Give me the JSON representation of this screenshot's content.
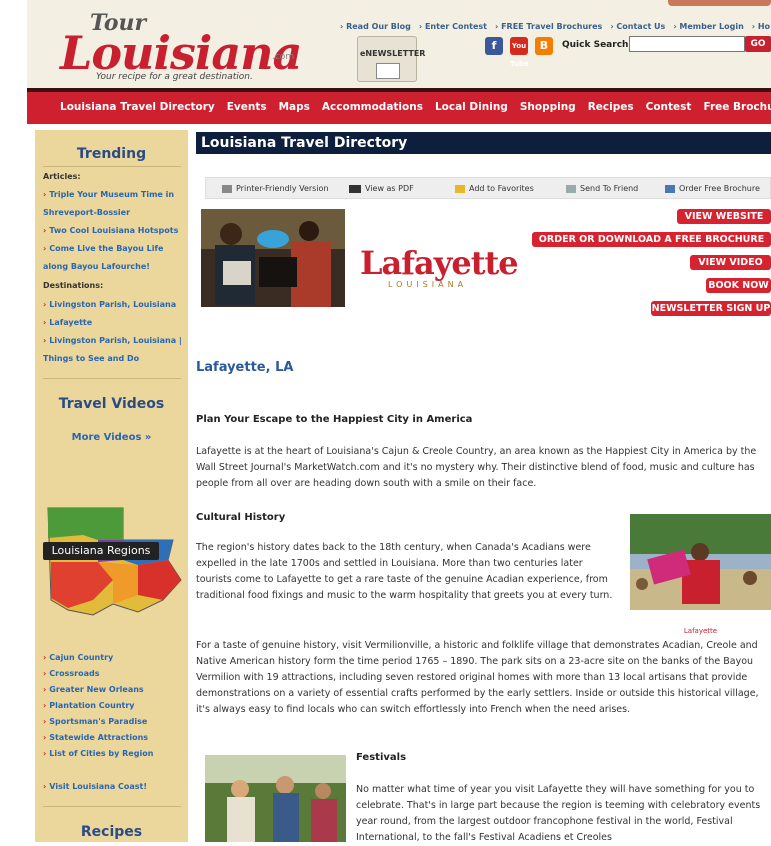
{
  "header": {
    "logo_tour": "Tour",
    "logo_main": "Louisiana",
    "logo_com": ".com",
    "tagline": "Your recipe for a great destination.",
    "newsletter": "eNEWSLETTER",
    "top_links": [
      "› Read Our Blog",
      "› Enter Contest",
      "› FREE Travel Brochures",
      "› Contact Us",
      "› Member Login",
      "› Ho"
    ],
    "search_label": "Quick Search:",
    "search_value": "",
    "search_button": "GO",
    "social": [
      "f",
      "You Tube",
      "B"
    ]
  },
  "nav": [
    "Louisiana Travel Directory",
    "Events",
    "Maps",
    "Accommodations",
    "Local Dining",
    "Shopping",
    "Recipes",
    "Contest",
    "Free Brochures"
  ],
  "sidebar": {
    "trending": "Trending",
    "articles_label": "Articles:",
    "articles": [
      "Triple Your Museum Time in Shreveport-Bossier",
      "Two Cool Louisiana Hotspots",
      "Come Live the Bayou Life along Bayou Lafourche!"
    ],
    "destinations_label": "Destinations:",
    "destinations": [
      "Livingston Parish, Louisiana",
      "Lafayette",
      "Livingston Parish, Louisiana | Things to See and Do"
    ],
    "travel_videos": "Travel Videos",
    "more_videos": "More Videos »",
    "regions_label": "Louisiana Regions",
    "regions": [
      "Cajun Country",
      "Crossroads",
      "Greater New Orleans",
      "Plantation Country",
      "Sportsman's Paradise",
      "Statewide Attractions",
      "List of Cities by Region"
    ],
    "coast": "Visit Louisiana Coast!",
    "recipes": "Recipes"
  },
  "content": {
    "title": "Louisiana Travel Directory",
    "tools": [
      "Printer-Friendly Version",
      "View as PDF",
      "Add to Favorites",
      "Send To Friend",
      "Order Free Brochure"
    ],
    "logo_text": "Lafayette",
    "logo_sub": "LOUISIANA",
    "buttons": [
      "VIEW WEBSITE",
      "ORDER OR DOWNLOAD A FREE BROCHURE",
      "VIEW VIDEO",
      "BOOK NOW",
      "NEWSLETTER SIGN UP"
    ],
    "heading": "Lafayette, LA",
    "escape_heading": "Plan Your Escape to the Happiest City in America",
    "escape_text": "Lafayette is at the heart of Louisiana's Cajun & Creole Country, an area known as the Happiest City in America by the Wall Street Journal's MarketWatch.com and it's no mystery why. Their distinctive blend of food, music and culture has people from all over are heading down south with a smile on their face.",
    "culture_heading": "Cultural History",
    "culture_text": "The region's history dates back to the 18th century, when Canada's Acadians were expelled in the late 1700s and settled in Louisiana. More than two centuries later tourists come to Lafayette to get a rare taste of the genuine Acadian experience, from traditional food fixings and music to the warm hospitality that greets you at every turn.",
    "photo_caption": "Lafayette",
    "vermilion_text": "For a taste of genuine history, visit Vermilionville, a historic and folklife village that demonstrates Acadian, Creole and Native American history form the time period 1765 – 1890. The park sits on a 23-acre site on the banks of the Bayou Vermilion with 19 attractions, including seven restored original homes with more than 13 local artisans that provide demonstrations on a variety of essential crafts performed by the early settlers. Inside or outside this historical village, it's always easy to find locals who can switch effortlessly into French when the need arises.",
    "festivals_heading": "Festivals",
    "festivals_text": "No matter what time of year you visit Lafayette they will have something for you to celebrate. That's in large part because the region is teeming with celebratory events year round, from the largest outdoor francophone festival in the world, Festival International, to the fall's Festival Acadiens et Creoles"
  },
  "colors": {
    "brand_red": "#ce202f",
    "title_navy": "#0e1f3d",
    "sidebar_tan": "#ebd79c",
    "link_blue": "#2a66b0"
  }
}
